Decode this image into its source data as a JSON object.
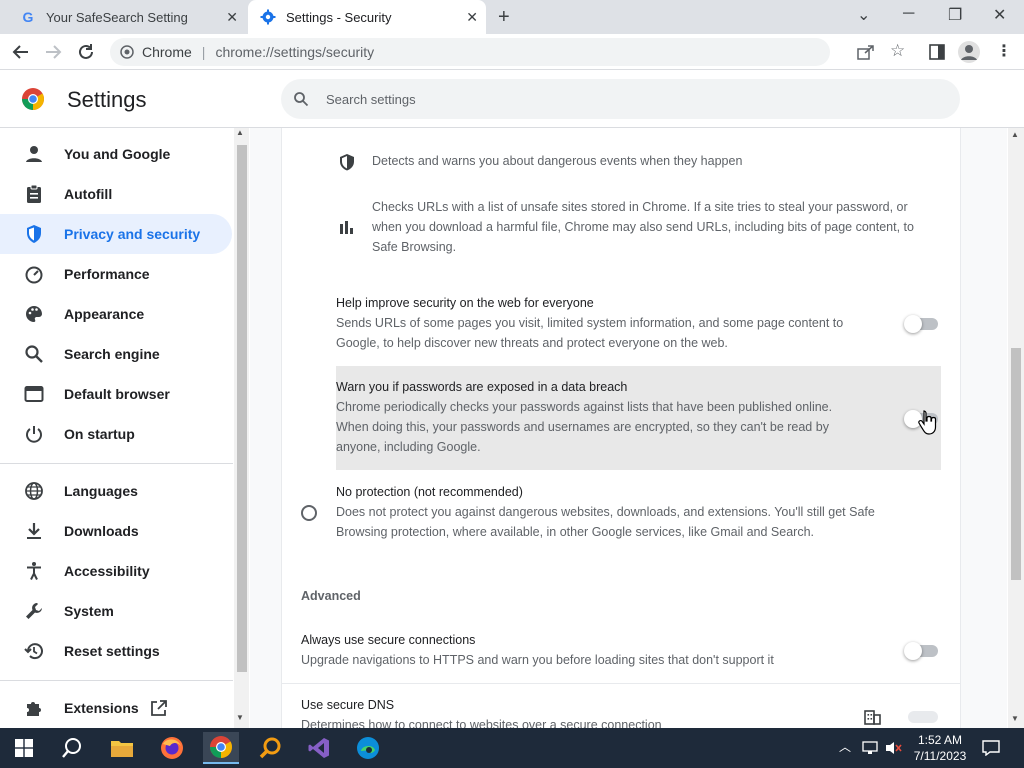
{
  "browser": {
    "tabs": [
      {
        "title": "Your SafeSearch Setting",
        "active": false
      },
      {
        "title": "Settings - Security",
        "active": true
      }
    ],
    "omnibox": {
      "site_chip": "Chrome",
      "url": "chrome://settings/security"
    }
  },
  "header": {
    "title": "Settings",
    "search_placeholder": "Search settings"
  },
  "sidebar": {
    "items": [
      {
        "label": "You and Google",
        "icon": "person-icon"
      },
      {
        "label": "Autofill",
        "icon": "clipboard-icon"
      },
      {
        "label": "Privacy and security",
        "icon": "shield-icon",
        "active": true
      },
      {
        "label": "Performance",
        "icon": "speedometer-icon"
      },
      {
        "label": "Appearance",
        "icon": "palette-icon"
      },
      {
        "label": "Search engine",
        "icon": "search-icon"
      },
      {
        "label": "Default browser",
        "icon": "browser-window-icon"
      },
      {
        "label": "On startup",
        "icon": "power-icon"
      }
    ],
    "items2": [
      {
        "label": "Languages",
        "icon": "globe-icon"
      },
      {
        "label": "Downloads",
        "icon": "download-icon"
      },
      {
        "label": "Accessibility",
        "icon": "accessibility-icon"
      },
      {
        "label": "System",
        "icon": "wrench-icon"
      },
      {
        "label": "Reset settings",
        "icon": "history-icon"
      }
    ],
    "extensions": {
      "label": "Extensions",
      "icon": "puzzle-icon"
    }
  },
  "main": {
    "detect_text": "Detects and warns you about dangerous events when they happen",
    "checks_text_1": "Checks URLs with a list of unsafe sites stored in Chrome. If a site tries to steal your password, or",
    "checks_text_2": "when you download a harmful file, Chrome may also send URLs, including bits of page content, to",
    "checks_text_3": "Safe Browsing.",
    "help_title": "Help improve security on the web for everyone",
    "help_desc_1": "Sends URLs of some pages you visit, limited system information, and some page content to",
    "help_desc_2": "Google, to help discover new threats and protect everyone on the web.",
    "help_enabled": false,
    "pw_title": "Warn you if passwords are exposed in a data breach",
    "pw_desc_1": "Chrome periodically checks your passwords against lists that have been published online.",
    "pw_desc_2": "When doing this, your passwords and usernames are encrypted, so they can't be read by",
    "pw_desc_3": "anyone, including Google.",
    "pw_enabled": false,
    "noprot_title": "No protection (not recommended)",
    "noprot_desc_1": "Does not protect you against dangerous websites, downloads, and extensions. You'll still get Safe",
    "noprot_desc_2": "Browsing protection, where available, in other Google services, like Gmail and Search.",
    "advanced_label": "Advanced",
    "https_title": "Always use secure connections",
    "https_desc": "Upgrade navigations to HTTPS and warn you before loading sites that don't support it",
    "https_enabled": false,
    "dns_title": "Use secure DNS",
    "dns_desc": "Determines how to connect to websites over a secure connection"
  },
  "taskbar": {
    "time": "1:52 AM",
    "date": "7/11/2023"
  },
  "colors": {
    "accent": "#1a73e8",
    "active_bg": "#e8f0fe",
    "taskbar": "#1e2a3a"
  }
}
